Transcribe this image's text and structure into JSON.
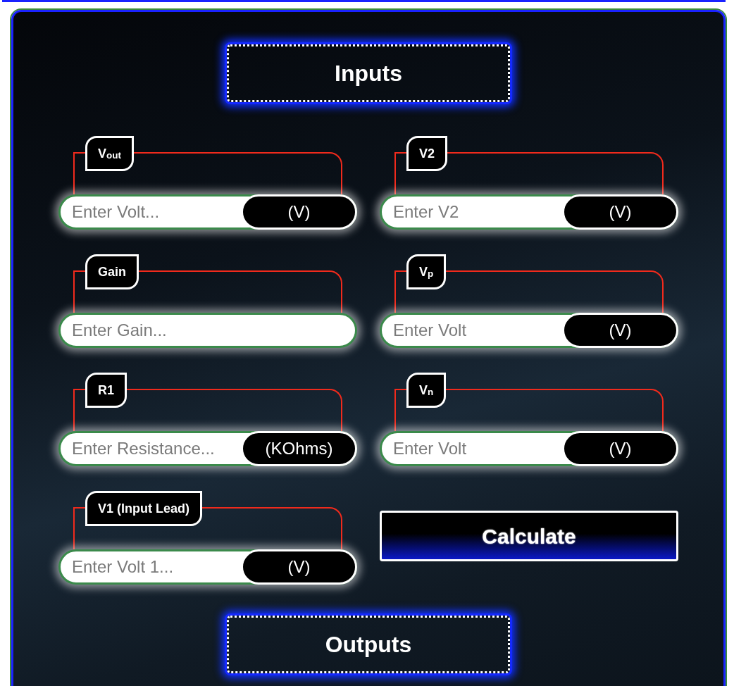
{
  "inputs_header": {
    "title": "Inputs"
  },
  "fields": [
    {
      "label": "V$_{out}$",
      "placeholder": "Enter Volt...",
      "unit": "(V)"
    },
    {
      "label": "V2",
      "placeholder": "Enter V2",
      "unit": "(V)"
    },
    {
      "label": "Gain",
      "placeholder": "Enter Gain..."
    },
    {
      "label": "V$_{p}$",
      "placeholder": "Enter Volt",
      "unit": "(V)"
    },
    {
      "label": "R1",
      "placeholder": "Enter Resistance...",
      "unit": "(KOhms)"
    },
    {
      "label": "V$_{n}$",
      "placeholder": "Enter Volt",
      "unit": "(V)"
    },
    {
      "label": "V1 (Input Lead)",
      "placeholder": "Enter Volt 1...",
      "unit": "(V)"
    }
  ],
  "calculate_button": {
    "label": "Calculate"
  },
  "outputs_header": {
    "title": "Outputs"
  }
}
